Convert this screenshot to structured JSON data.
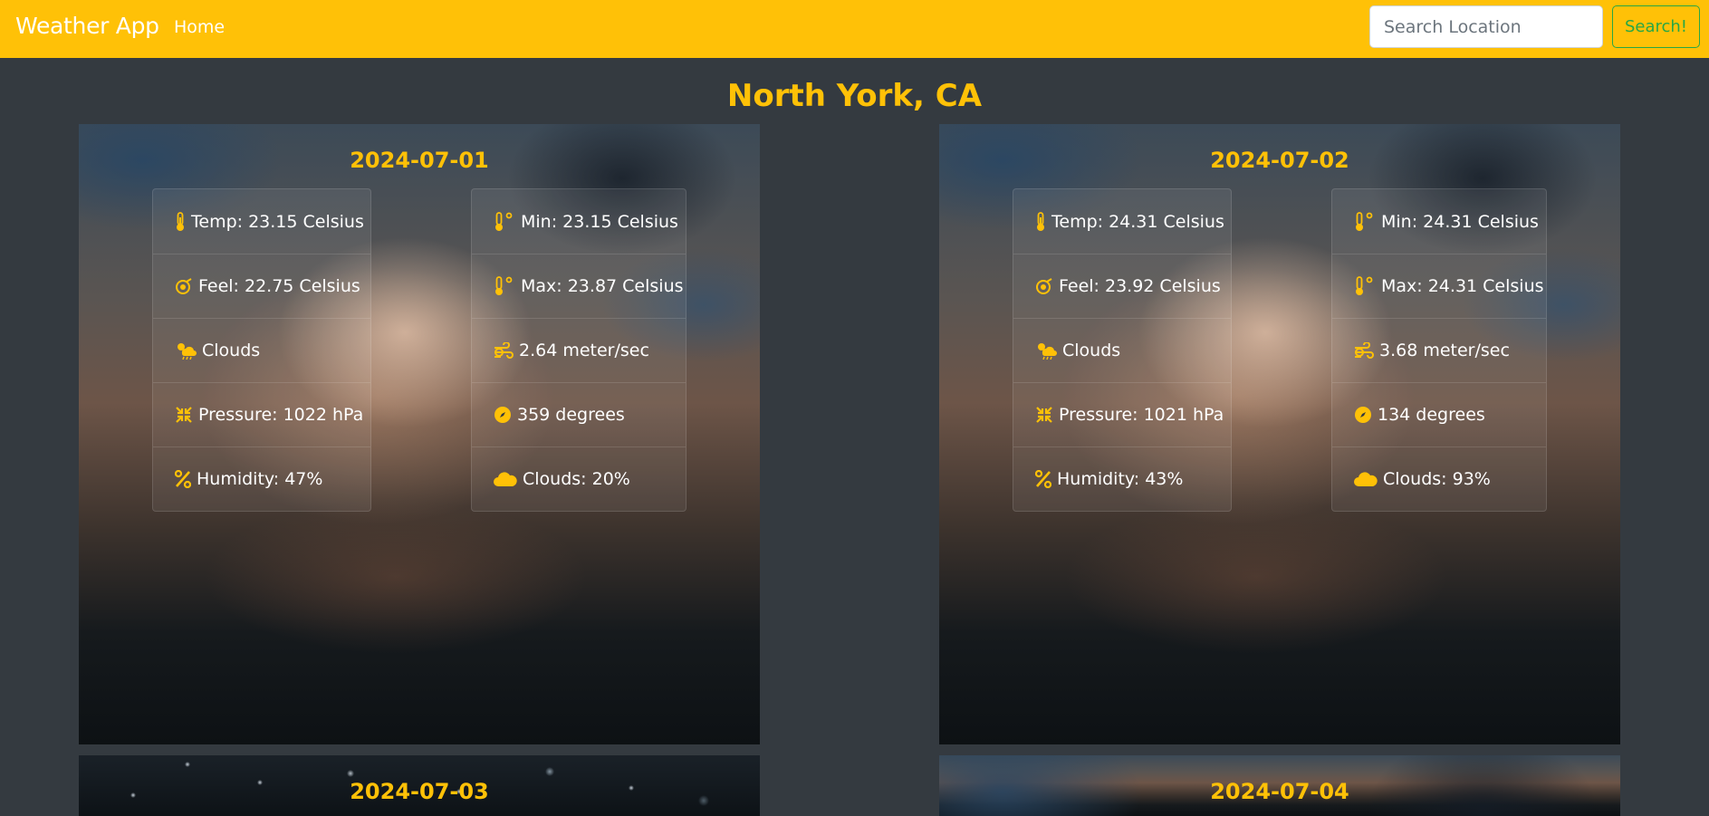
{
  "navbar": {
    "brand": "Weather App",
    "home": "Home",
    "search_placeholder": "Search Location",
    "search_button": "Search!",
    "bg_color": "#ffc107"
  },
  "page": {
    "title": "North York, CA",
    "bg_color": "#343a40",
    "accent": "#ffc107"
  },
  "cards": [
    {
      "date": "2024-07-01",
      "left": [
        {
          "icon": "thermometer-icon",
          "text": "Temp: 23.15 Celsius"
        },
        {
          "icon": "feel-icon",
          "text": "Feel: 22.75 Celsius"
        },
        {
          "icon": "cloud-sun-rain-icon",
          "text": "Clouds"
        },
        {
          "icon": "compress-icon",
          "text": "Pressure: 1022 hPa"
        },
        {
          "icon": "percent-icon",
          "text": "Humidity: 47%"
        }
      ],
      "right": [
        {
          "icon": "temp-min-icon",
          "text": "Min: 23.15 Celsius"
        },
        {
          "icon": "temp-max-icon",
          "text": "Max: 23.87 Celsius"
        },
        {
          "icon": "wind-icon",
          "text": "2.64 meter/sec"
        },
        {
          "icon": "compass-icon",
          "text": "359 degrees"
        },
        {
          "icon": "cloud-icon",
          "text": "Clouds: 20%"
        }
      ]
    },
    {
      "date": "2024-07-02",
      "left": [
        {
          "icon": "thermometer-icon",
          "text": "Temp: 24.31 Celsius"
        },
        {
          "icon": "feel-icon",
          "text": "Feel: 23.92 Celsius"
        },
        {
          "icon": "cloud-sun-rain-icon",
          "text": "Clouds"
        },
        {
          "icon": "compress-icon",
          "text": "Pressure: 1021 hPa"
        },
        {
          "icon": "percent-icon",
          "text": "Humidity: 43%"
        }
      ],
      "right": [
        {
          "icon": "temp-min-icon",
          "text": "Min: 24.31 Celsius"
        },
        {
          "icon": "temp-max-icon",
          "text": "Max: 24.31 Celsius"
        },
        {
          "icon": "wind-icon",
          "text": "3.68 meter/sec"
        },
        {
          "icon": "compass-icon",
          "text": "134 degrees"
        },
        {
          "icon": "cloud-icon",
          "text": "Clouds: 93%"
        }
      ]
    },
    {
      "date": "2024-07-03"
    },
    {
      "date": "2024-07-04"
    }
  ]
}
